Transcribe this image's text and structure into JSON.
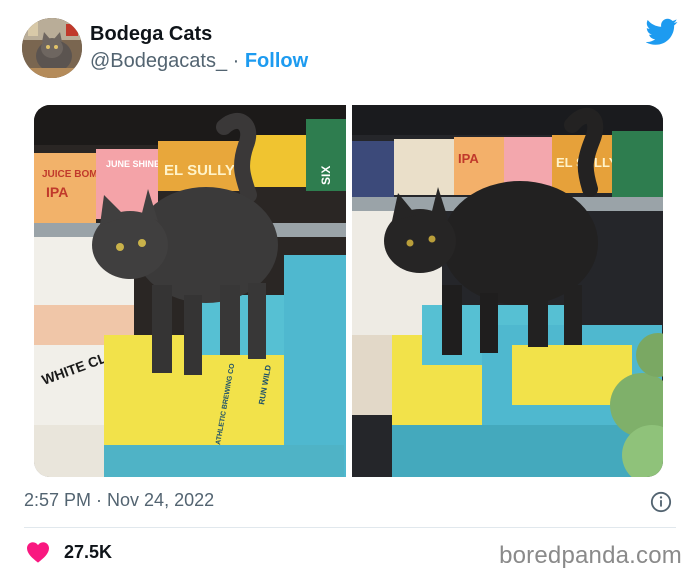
{
  "account": {
    "name": "Bodega Cats",
    "handle": "@Bodegacats_",
    "separator": "·",
    "follow_label": "Follow"
  },
  "tweet": {
    "timestamp": "2:57 PM · Nov 24, 2022",
    "like_count": "27.5K"
  },
  "product_labels": {
    "juice_bomb": "JUICE BOMB",
    "ipa": "IPA",
    "june_shine": "JUNE SHINE",
    "el_sully": "EL SULLY",
    "six": "SIX",
    "white_claw": "WHITE CLAW",
    "run_wild": "RUN WILD",
    "athletic": "ATHLETIC BREWING CO"
  },
  "watermark": "boredpanda.com",
  "colors": {
    "follow_blue": "#1d9bf0",
    "twitter_blue": "#1d9bf0",
    "heart_pink": "#f91880",
    "secondary_text": "#536471"
  },
  "icons": {
    "brand": "twitter-bird-icon",
    "info": "info-icon",
    "like": "heart-icon"
  }
}
